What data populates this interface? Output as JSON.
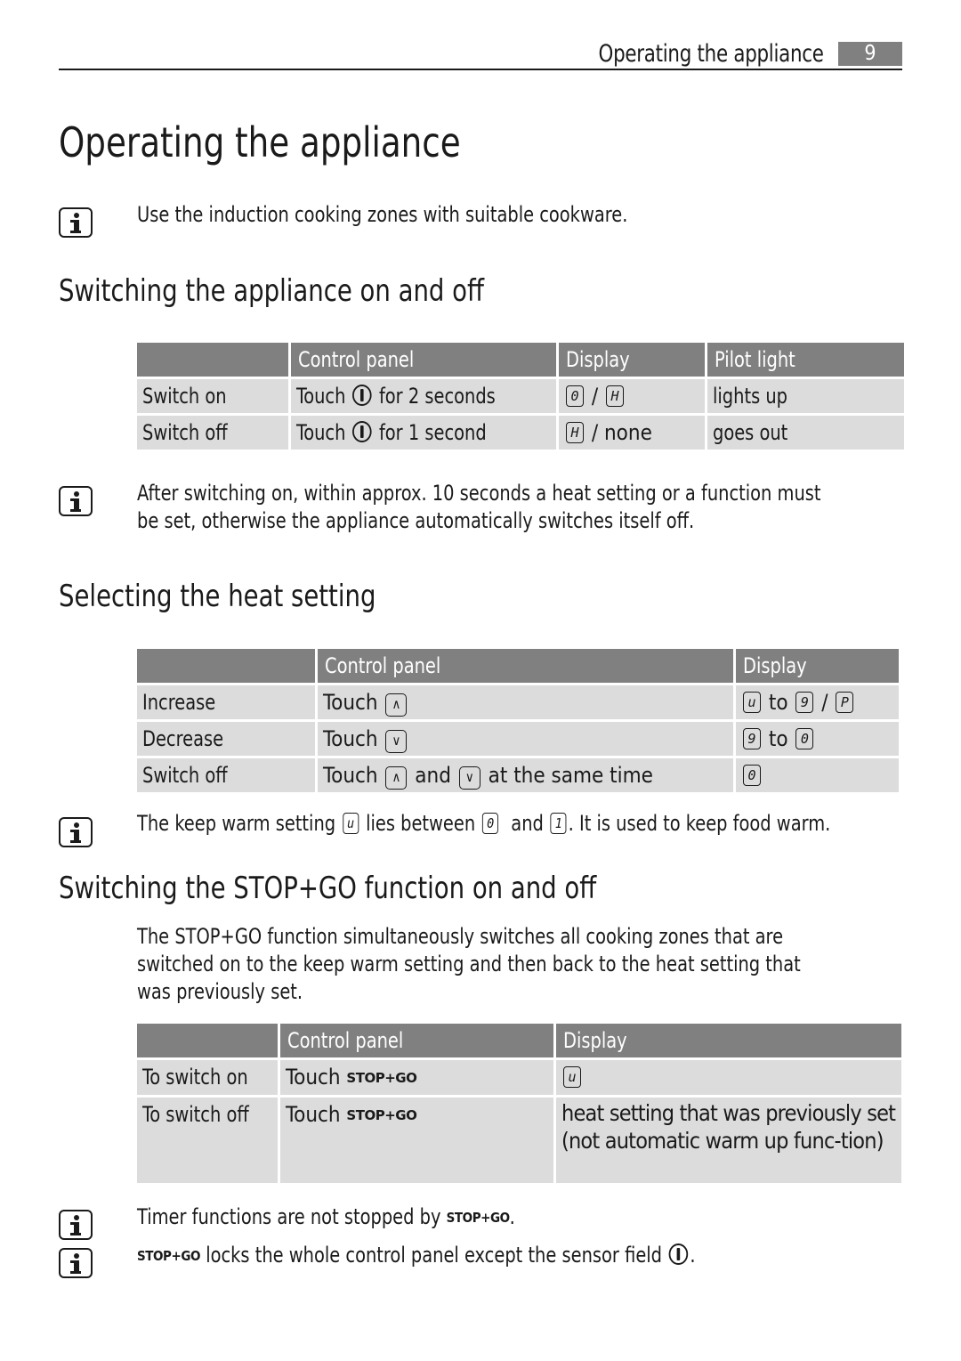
{
  "header": {
    "running_title": "Operating the appliance",
    "page_number": "9"
  },
  "page_title": "Operating the appliance",
  "notes": {
    "cookware": "Use the induction cooking zones with suitable cookware.",
    "auto_off_line1": "After switching on, within approx. 10 seconds a heat setting or a function must",
    "auto_off_line2": "be set, otherwise the appliance automatically switches itself off.",
    "keep_warm": {
      "p1": "The keep warm setting",
      "g1": "u",
      "p2": "lies between",
      "g2": "0",
      "p3": "and",
      "g3": "1",
      "p4": ". It is used to keep food warm."
    },
    "timer": {
      "text": "Timer functions are not stopped by",
      "stopgo": "STOP+GO",
      "end": "."
    },
    "lock": {
      "stopgo": "STOP+GO",
      "text": "locks the whole control panel except the sensor field",
      "end": "."
    }
  },
  "sections": {
    "on_off": {
      "heading": "Switching the appliance on and off",
      "table": {
        "headers": [
          "",
          "Control panel",
          "Display",
          "Pilot light"
        ],
        "rows": [
          {
            "action": "Switch on",
            "touch": "Touch",
            "duration": "for 2 seconds",
            "display_a": "0",
            "sep": "/",
            "display_b": "H",
            "pilot": "lights up"
          },
          {
            "action": "Switch off",
            "touch": "Touch",
            "duration": "for 1 second",
            "display_a": "H",
            "sep": "/ none",
            "pilot": "goes out"
          }
        ]
      }
    },
    "heat": {
      "heading": "Selecting the heat setting",
      "table": {
        "headers": [
          "",
          "Control panel",
          "Display"
        ],
        "rows": [
          {
            "action": "Increase",
            "touch": "Touch",
            "key": "up",
            "d1": "u",
            "to": "to",
            "d2": "9",
            "sep": "/",
            "d3": "P"
          },
          {
            "action": "Decrease",
            "touch": "Touch",
            "key": "down",
            "d1": "9",
            "to": "to",
            "d2": "0"
          },
          {
            "action": "Switch off",
            "touch": "Touch",
            "and": "and",
            "same_time": "at the same time",
            "d1": "0"
          }
        ]
      }
    },
    "stopgo": {
      "heading": "Switching the STOP+GO function on and off",
      "intro_line1": "The STOP+GO function simultaneously switches all cooking zones that are",
      "intro_line2": "switched on to the keep warm setting and then back to the heat setting that",
      "intro_line3": "was previously set.",
      "table": {
        "headers": [
          "",
          "Control panel",
          "Display"
        ],
        "rows": [
          {
            "action": "To switch on",
            "touch": "Touch",
            "stopgo": "STOP+GO",
            "display_glyph": "u"
          },
          {
            "action": "To switch off",
            "touch": "Touch",
            "stopgo": "STOP+GO",
            "display_text": "heat setting that was previously set (not automatic warm up func-tion)"
          }
        ]
      }
    }
  }
}
